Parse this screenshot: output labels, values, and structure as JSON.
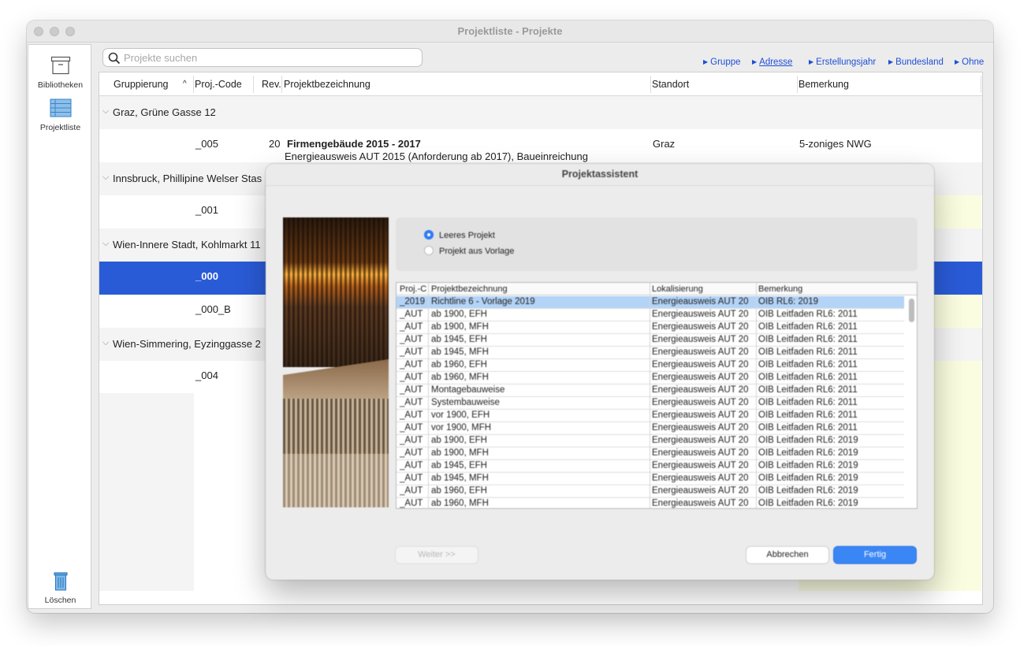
{
  "window": {
    "title": "Projektliste - Projekte"
  },
  "sidebar": {
    "items": [
      {
        "label": "Bibliotheken",
        "icon": "archive-box-icon"
      },
      {
        "label": "Projektliste",
        "icon": "list-icon"
      }
    ],
    "delete": {
      "label": "Löschen",
      "icon": "trash-icon"
    }
  },
  "search": {
    "placeholder": "Projekte suchen",
    "value": ""
  },
  "groupby": [
    {
      "label": "Gruppe",
      "active": false
    },
    {
      "label": "Adresse",
      "active": true
    },
    {
      "label": "Erstellungsjahr",
      "active": false
    },
    {
      "label": "Bundesland",
      "active": false
    },
    {
      "label": "Ohne",
      "active": false
    }
  ],
  "table": {
    "columns": {
      "gruppierung": "Gruppierung",
      "sort": "^",
      "code": "Proj.-Code",
      "rev": "Rev.",
      "bezeichnung": "Projektbezeichnung",
      "standort": "Standort",
      "bemerkung": "Bemerkung"
    },
    "groups": [
      {
        "name": "Graz, Grüne Gasse 12"
      },
      {
        "name": "Innsbruck, Phillipine Welser Stas"
      },
      {
        "name": "Wien-Innere Stadt, Kohlmarkt 11"
      },
      {
        "name": "Wien-Simmering, Eyzinggasse 2"
      }
    ],
    "rows": [
      {
        "code": "_005",
        "rev": "20",
        "title": "Firmengebäude 2015 - 2017",
        "subtitle": "Energieausweis AUT 2015 (Anforderung ab 2017), Baueinreichung",
        "standort": "Graz",
        "bemerkung": "5-zoniges NWG"
      },
      {
        "code": "_001"
      },
      {
        "code": "_000",
        "selected": true
      },
      {
        "code": "_000_B"
      },
      {
        "code": "_004"
      }
    ]
  },
  "dialog": {
    "title": "Projektassistent",
    "options": [
      {
        "label": "Leeres Projekt",
        "checked": true
      },
      {
        "label": "Projekt aus Vorlage",
        "checked": false
      }
    ],
    "template_table": {
      "columns": [
        "Proj.-C",
        "Projektbezeichnung",
        "Lokalisierung",
        "Bemerkung"
      ],
      "rows": [
        [
          "_2019",
          "Richtline 6 - Vorlage 2019",
          "Energieausweis AUT 20",
          "OIB RL6: 2019"
        ],
        [
          "_AUT",
          "ab 1900, EFH",
          "Energieausweis AUT 20",
          "OIB Leitfaden RL6: 2011"
        ],
        [
          "_AUT",
          "ab 1900, MFH",
          "Energieausweis AUT 20",
          "OIB Leitfaden RL6: 2011"
        ],
        [
          "_AUT",
          "ab 1945, EFH",
          "Energieausweis AUT 20",
          "OIB Leitfaden RL6: 2011"
        ],
        [
          "_AUT",
          "ab 1945, MFH",
          "Energieausweis AUT 20",
          "OIB Leitfaden RL6: 2011"
        ],
        [
          "_AUT",
          "ab 1960, EFH",
          "Energieausweis AUT 20",
          "OIB Leitfaden RL6: 2011"
        ],
        [
          "_AUT",
          "ab 1960, MFH",
          "Energieausweis AUT 20",
          "OIB Leitfaden RL6: 2011"
        ],
        [
          "_AUT",
          "Montagebauweise",
          "Energieausweis AUT 20",
          "OIB Leitfaden RL6: 2011"
        ],
        [
          "_AUT",
          "Systembauweise",
          "Energieausweis AUT 20",
          "OIB Leitfaden RL6: 2011"
        ],
        [
          "_AUT",
          "vor 1900, EFH",
          "Energieausweis AUT 20",
          "OIB Leitfaden RL6: 2011"
        ],
        [
          "_AUT",
          "vor 1900, MFH",
          "Energieausweis AUT 20",
          "OIB Leitfaden RL6: 2011"
        ],
        [
          "_AUT",
          "ab 1900, EFH",
          "Energieausweis AUT 20",
          "OIB Leitfaden RL6: 2019"
        ],
        [
          "_AUT",
          "ab 1900, MFH",
          "Energieausweis AUT 20",
          "OIB Leitfaden RL6: 2019"
        ],
        [
          "_AUT",
          "ab 1945, EFH",
          "Energieausweis AUT 20",
          "OIB Leitfaden RL6: 2019"
        ],
        [
          "_AUT",
          "ab 1945, MFH",
          "Energieausweis AUT 20",
          "OIB Leitfaden RL6: 2019"
        ],
        [
          "_AUT",
          "ab 1960, EFH",
          "Energieausweis AUT 20",
          "OIB Leitfaden RL6: 2019"
        ],
        [
          "_AUT",
          "ab 1960, MFH",
          "Energieausweis AUT 20",
          "OIB Leitfaden RL6: 2019"
        ]
      ]
    },
    "buttons": {
      "weiter": "Weiter >>",
      "abbrechen": "Abbrechen",
      "fertig": "Fertig"
    }
  },
  "colors": {
    "accent": "#2a5bd7",
    "note_bg": "#fbfde0",
    "primary_button": "#3b86f5",
    "link": "#1f4fd8"
  }
}
